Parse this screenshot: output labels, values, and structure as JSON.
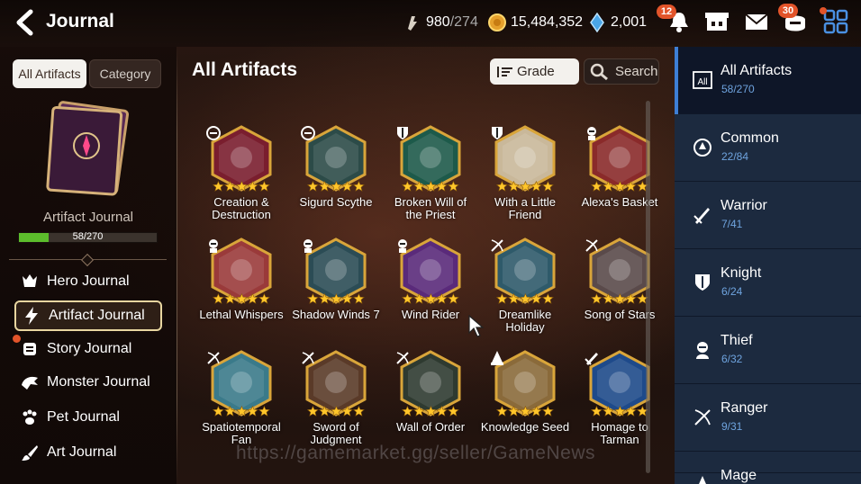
{
  "header": {
    "title": "Journal",
    "resources": [
      {
        "icon": "stamina-icon",
        "value": "980",
        "max": "/274"
      },
      {
        "icon": "gold-coin-icon",
        "value": "15,484,352"
      },
      {
        "icon": "skystone-icon",
        "value": "2,001"
      }
    ],
    "icons": [
      {
        "name": "notification-bell-icon",
        "badge": "12"
      },
      {
        "name": "shop-icon"
      },
      {
        "name": "mail-icon"
      },
      {
        "name": "mission-icon",
        "badge": "30"
      },
      {
        "name": "menu-grid-icon",
        "badge": ""
      }
    ]
  },
  "left": {
    "segments": [
      "All Artifacts",
      "Category"
    ],
    "journal_label": "Artifact Journal",
    "progress_text": "58/270",
    "progress_fraction": 0.215,
    "nav": [
      {
        "label": "Hero Journal",
        "icon": "hero-icon"
      },
      {
        "label": "Artifact Journal",
        "icon": "lightning-icon"
      },
      {
        "label": "Story Journal",
        "icon": "scroll-icon"
      },
      {
        "label": "Monster Journal",
        "icon": "monster-icon"
      },
      {
        "label": "Pet Journal",
        "icon": "paw-icon"
      },
      {
        "label": "Art Journal",
        "icon": "brush-icon"
      }
    ]
  },
  "main": {
    "title": "All Artifacts",
    "sort_label": "Grade",
    "search_label": "Search",
    "artifacts": [
      {
        "name": "Creation &\nDestruction",
        "role": "common",
        "color": "#7a1e2e"
      },
      {
        "name": "Sigurd Scythe",
        "role": "common",
        "color": "#2c4b48"
      },
      {
        "name": "Broken Will of\nthe Priest",
        "role": "knight",
        "color": "#1d5a4a"
      },
      {
        "name": "With a Little\nFriend",
        "role": "knight",
        "color": "#c9b89a"
      },
      {
        "name": "Alexa's Basket",
        "role": "thief",
        "color": "#8a2a2a"
      },
      {
        "name": "Lethal Whispers",
        "role": "thief",
        "color": "#9a3a3a"
      },
      {
        "name": "Shadow Winds 7",
        "role": "thief",
        "color": "#2b4c55"
      },
      {
        "name": "Wind Rider",
        "role": "thief",
        "color": "#5a2a7a"
      },
      {
        "name": "Dreamlike\nHoliday",
        "role": "ranger",
        "color": "#2e5a6a"
      },
      {
        "name": "Song of Stars",
        "role": "ranger",
        "color": "#5a4a4a"
      },
      {
        "name": "Spatiotemporal\nFan",
        "role": "ranger",
        "color": "#3a7a8a"
      },
      {
        "name": "Sword of\nJudgment",
        "role": "ranger",
        "color": "#5a3a28"
      },
      {
        "name": "Wall of Order",
        "role": "ranger",
        "color": "#2e3a30"
      },
      {
        "name": "Knowledge Seed",
        "role": "mage",
        "color": "#8a6a3a"
      },
      {
        "name": "Homage to\nTarman",
        "role": "warrior",
        "color": "#1e4a8a"
      }
    ]
  },
  "categories": [
    {
      "label": "All Artifacts",
      "count": "58/270",
      "icon": "all-icon"
    },
    {
      "label": "Common",
      "count": "22/84",
      "icon": "common-icon"
    },
    {
      "label": "Warrior",
      "count": "7/41",
      "icon": "warrior-icon"
    },
    {
      "label": "Knight",
      "count": "6/24",
      "icon": "knight-icon"
    },
    {
      "label": "Thief",
      "count": "6/32",
      "icon": "thief-icon"
    },
    {
      "label": "Ranger",
      "count": "9/31",
      "icon": "ranger-icon"
    },
    {
      "label": "Mage",
      "count": "",
      "icon": "mage-icon"
    }
  ],
  "watermark": "https://gamemarket.gg/seller/GameNews",
  "colors": {
    "accent_blue": "#3d7fd6",
    "progress_green": "#5cbd2c",
    "badge_orange": "#e2542a",
    "gold_frame": "#d9a53a"
  }
}
